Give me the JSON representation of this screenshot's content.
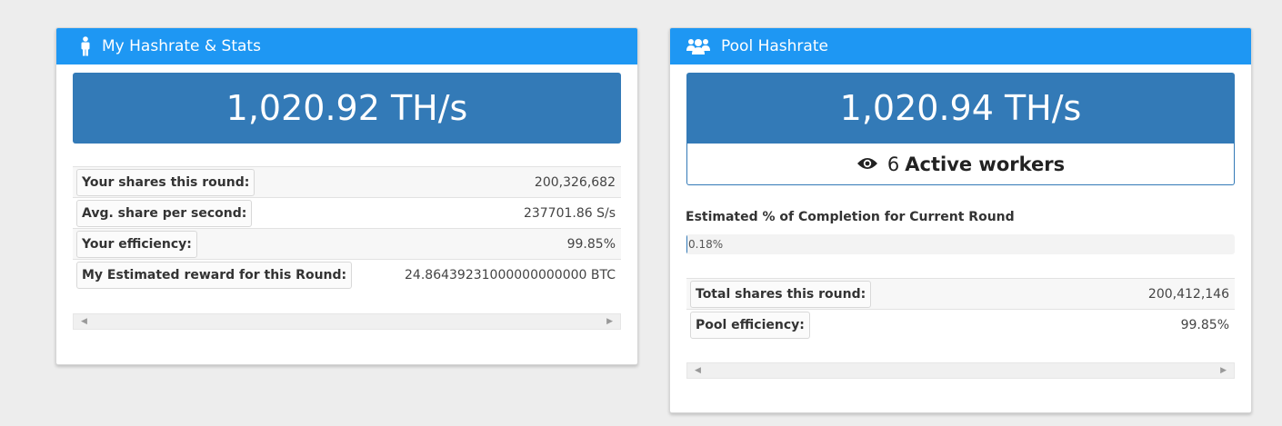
{
  "my_stats": {
    "title": "My Hashrate & Stats",
    "icon": "person-icon",
    "hashrate": "1,020.92 TH/s",
    "rows": [
      {
        "label": "Your shares this round:",
        "value": "200,326,682"
      },
      {
        "label": "Avg. share per second:",
        "value": "237701.86 S/s"
      },
      {
        "label": "Your efficiency:",
        "value": "99.85%"
      },
      {
        "label": "My Estimated reward for this Round:",
        "value": "24.86439231000000000000 BTC"
      }
    ]
  },
  "pool": {
    "title": "Pool Hashrate",
    "icon": "users-icon",
    "hashrate": "1,020.94 TH/s",
    "workers_count": "6",
    "workers_label": "Active workers",
    "completion_title": "Estimated % of Completion for Current Round",
    "completion_text": "0.18%",
    "completion_percent": 0.18,
    "rows": [
      {
        "label": "Total shares this round:",
        "value": "200,412,146"
      },
      {
        "label": "Pool efficiency:",
        "value": "99.85%"
      }
    ]
  },
  "colors": {
    "header": "#1e97f3",
    "rate_box": "#337ab7"
  }
}
